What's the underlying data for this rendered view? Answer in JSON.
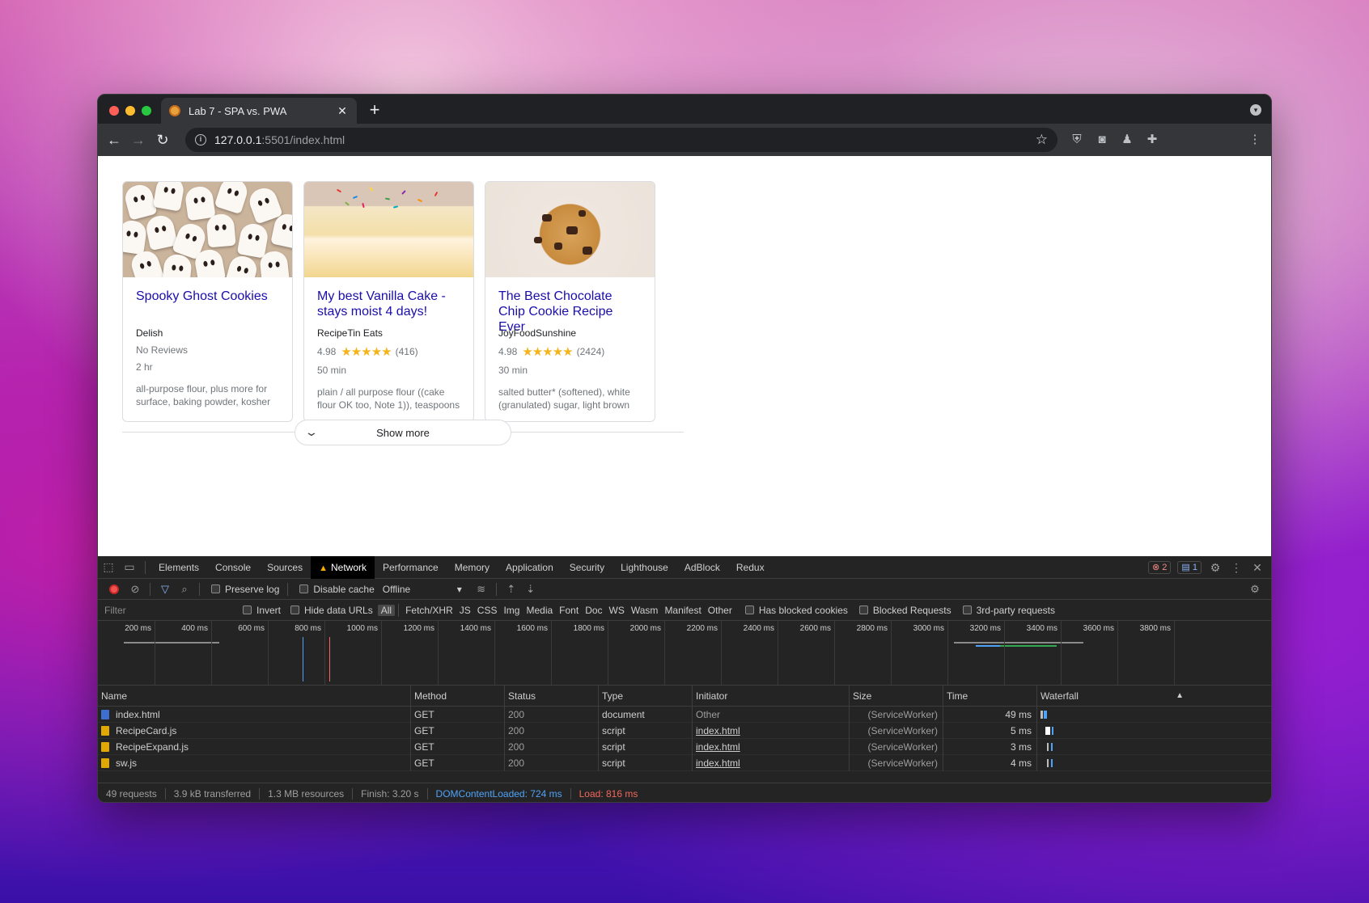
{
  "browser": {
    "tab_title": "Lab 7 - SPA vs. PWA",
    "url_host": "127.0.0.1",
    "url_path": ":5501/index.html"
  },
  "recipes": [
    {
      "title": "Spooky Ghost Cookies",
      "source": "Delish",
      "rating_text": "No Reviews",
      "rating": null,
      "reviews": "",
      "time": "2 hr",
      "ingredients": "all-purpose flour, plus more for surface, baking powder, kosher"
    },
    {
      "title": "My best Vanilla Cake - stays moist 4 days!",
      "source": "RecipeTin Eats",
      "rating_text": "4.98",
      "rating": 4.98,
      "reviews": "(416)",
      "time": "50 min",
      "ingredients": "plain / all purpose flour ((cake flour OK too, Note 1)), teaspoons"
    },
    {
      "title": "The Best Chocolate Chip Cookie Recipe Ever",
      "source": "JoyFoodSunshine",
      "rating_text": "4.98",
      "rating": 4.98,
      "reviews": "(2424)",
      "time": "30 min",
      "ingredients": "salted butter* (softened), white (granulated) sugar, light brown"
    }
  ],
  "show_more_label": "Show more",
  "devtools": {
    "tabs": [
      "Elements",
      "Console",
      "Sources",
      "Network",
      "Performance",
      "Memory",
      "Application",
      "Security",
      "Lighthouse",
      "AdBlock",
      "Redux"
    ],
    "active_tab": "Network",
    "error_count": "2",
    "message_count": "1",
    "toolbar": {
      "preserve_log": "Preserve log",
      "disable_cache": "Disable cache",
      "throttle": "Offline"
    },
    "filter": {
      "placeholder": "Filter",
      "invert": "Invert",
      "hide_data_urls": "Hide data URLs",
      "types": [
        "All",
        "Fetch/XHR",
        "JS",
        "CSS",
        "Img",
        "Media",
        "Font",
        "Doc",
        "WS",
        "Wasm",
        "Manifest",
        "Other"
      ],
      "active_type": "All",
      "has_blocked_cookies": "Has blocked cookies",
      "blocked_requests": "Blocked Requests",
      "third_party": "3rd-party requests"
    },
    "overview_ticks": [
      "200 ms",
      "400 ms",
      "600 ms",
      "800 ms",
      "1000 ms",
      "1200 ms",
      "1400 ms",
      "1600 ms",
      "1800 ms",
      "2000 ms",
      "2200 ms",
      "2400 ms",
      "2600 ms",
      "2800 ms",
      "3000 ms",
      "3200 ms",
      "3400 ms",
      "3600 ms",
      "3800 ms"
    ],
    "columns": [
      "Name",
      "Method",
      "Status",
      "Type",
      "Initiator",
      "Size",
      "Time",
      "Waterfall"
    ],
    "requests": [
      {
        "name": "index.html",
        "kind": "doc",
        "method": "GET",
        "status": "200",
        "type": "document",
        "initiator": "Other",
        "initiator_link": false,
        "size": "(ServiceWorker)",
        "time": "49 ms"
      },
      {
        "name": "RecipeCard.js",
        "kind": "js",
        "method": "GET",
        "status": "200",
        "type": "script",
        "initiator": "index.html",
        "initiator_link": true,
        "size": "(ServiceWorker)",
        "time": "5 ms"
      },
      {
        "name": "RecipeExpand.js",
        "kind": "js",
        "method": "GET",
        "status": "200",
        "type": "script",
        "initiator": "index.html",
        "initiator_link": true,
        "size": "(ServiceWorker)",
        "time": "3 ms"
      },
      {
        "name": "sw.js",
        "kind": "js",
        "method": "GET",
        "status": "200",
        "type": "script",
        "initiator": "index.html",
        "initiator_link": true,
        "size": "(ServiceWorker)",
        "time": "4 ms"
      }
    ],
    "summary": {
      "requests": "49 requests",
      "transferred": "3.9 kB transferred",
      "resources": "1.3 MB resources",
      "finish": "Finish: 3.20 s",
      "dom_content_loaded": "DOMContentLoaded: 724 ms",
      "load": "Load: 816 ms"
    },
    "colors": {
      "dom_line": "#4fa3f7",
      "load_line": "#f2675b"
    }
  }
}
